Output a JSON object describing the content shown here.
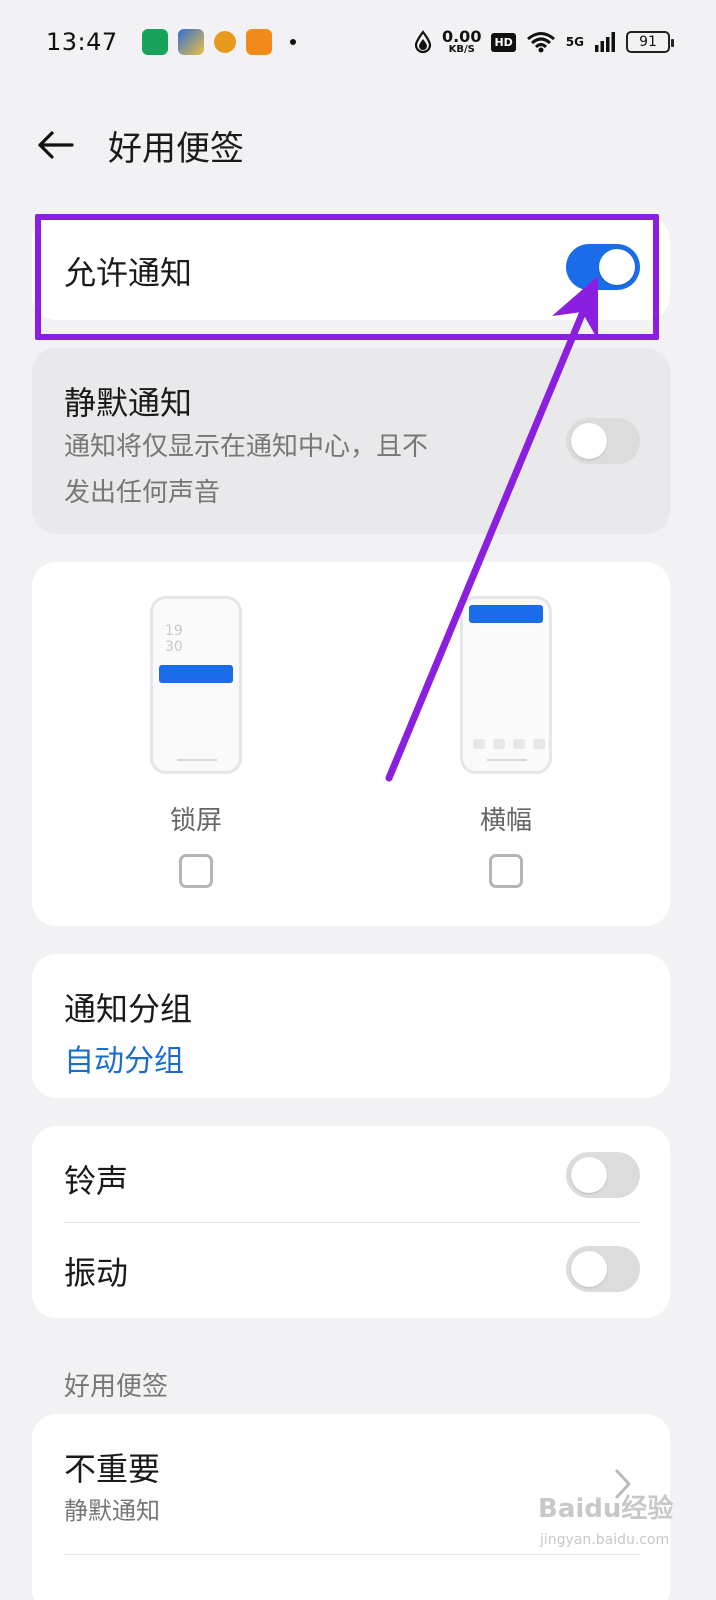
{
  "status_bar": {
    "time": "13:47",
    "speed_value": "0.00",
    "speed_unit": "KB/S",
    "hd": "HD",
    "network": "5G",
    "battery": "91",
    "icons": [
      "oppo-app-icon",
      "game-app-icon",
      "coin-app-icon",
      "video-app-icon",
      "notification-dot",
      "data-saver-icon",
      "wifi-icon",
      "signal-icon",
      "battery-icon"
    ]
  },
  "header": {
    "title": "好用便签"
  },
  "allow_notifications": {
    "label": "允许通知",
    "enabled": true
  },
  "silent_notifications": {
    "label": "静默通知",
    "description_line1": "通知将仅显示在通知中心，且不",
    "description_line2": "发出任何声音",
    "enabled": false
  },
  "display_options": [
    {
      "label": "锁屏",
      "clock_line1": "19",
      "clock_line2": "30",
      "checked": false
    },
    {
      "label": "横幅",
      "checked": false
    }
  ],
  "notification_group": {
    "label": "通知分组",
    "value": "自动分组"
  },
  "sound": {
    "ringtone": {
      "label": "铃声",
      "enabled": false
    },
    "vibration": {
      "label": "振动",
      "enabled": false
    }
  },
  "category_section": {
    "header": "好用便签",
    "items": [
      {
        "title": "不重要",
        "subtitle": "静默通知"
      }
    ]
  },
  "watermark": {
    "brand": "Baidu经验",
    "url": "jingyan.baidu.com"
  },
  "colors": {
    "accent": "#1a6ce8",
    "annotation": "#8a1fe0",
    "link": "#1a6cd0"
  }
}
